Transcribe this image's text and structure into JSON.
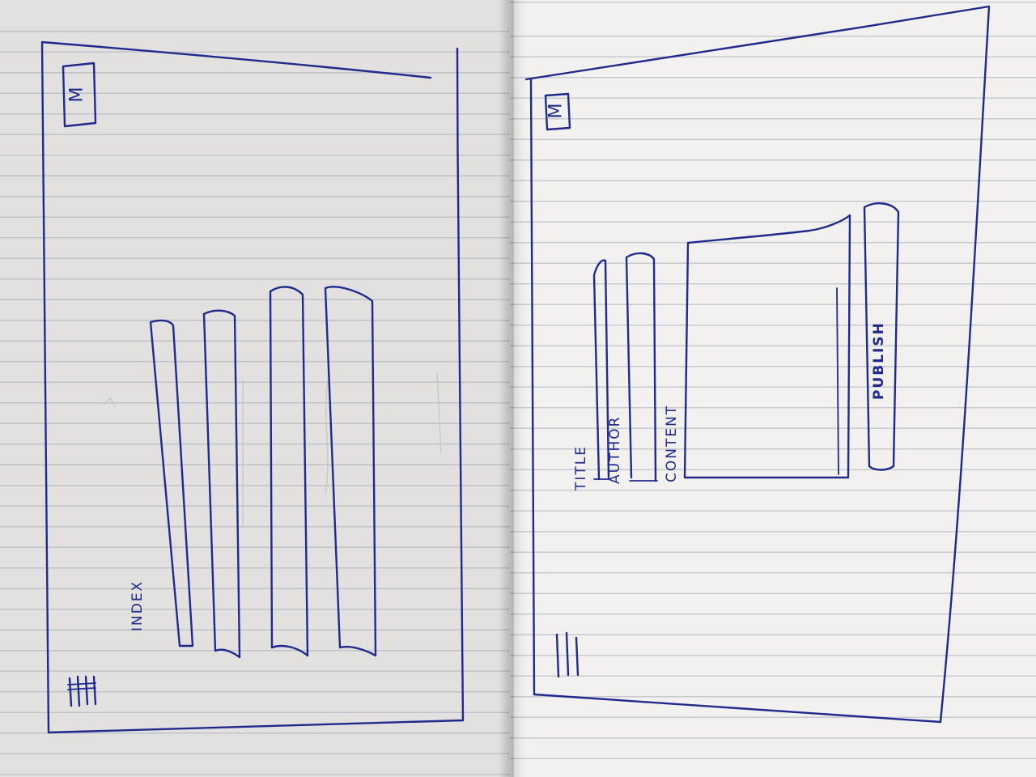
{
  "left_sketch": {
    "logo_letter": "M",
    "index_label": "INDEX"
  },
  "right_sketch": {
    "logo_letter": "M",
    "fields": {
      "title_label": "TITLE",
      "author_label": "AUTHOR",
      "content_label": "CONTENT"
    },
    "publish_label": "PUBLISH"
  },
  "ink_color": "#1f2a8c"
}
